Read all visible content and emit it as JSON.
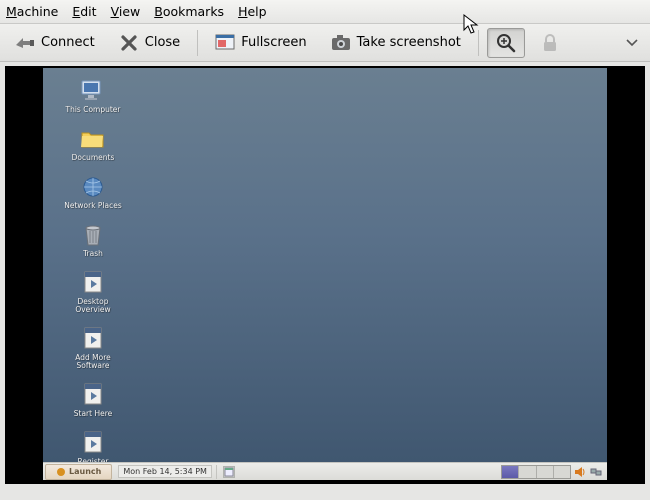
{
  "menubar": {
    "machine": "Machine",
    "edit": "Edit",
    "view": "View",
    "bookmarks": "Bookmarks",
    "help": "Help"
  },
  "toolbar": {
    "connect": "Connect",
    "close": "Close",
    "fullscreen": "Fullscreen",
    "screenshot": "Take screenshot"
  },
  "desktop_icons": [
    {
      "name": "this-computer",
      "label": "This Computer",
      "icon": "computer"
    },
    {
      "name": "documents",
      "label": "Documents",
      "icon": "folder"
    },
    {
      "name": "network-places",
      "label": "Network Places",
      "icon": "network"
    },
    {
      "name": "trash",
      "label": "Trash",
      "icon": "trash"
    },
    {
      "name": "desktop-overview",
      "label": "Desktop\nOverview",
      "icon": "file"
    },
    {
      "name": "add-more-software",
      "label": "Add More\nSoftware",
      "icon": "file"
    },
    {
      "name": "start-here",
      "label": "Start Here",
      "icon": "file"
    },
    {
      "name": "register-opensolaris",
      "label": "Register\nOpenSolaris",
      "icon": "file"
    }
  ],
  "taskbar": {
    "launch": "Launch",
    "date": "Mon Feb 14,",
    "time": "5:34 PM"
  }
}
